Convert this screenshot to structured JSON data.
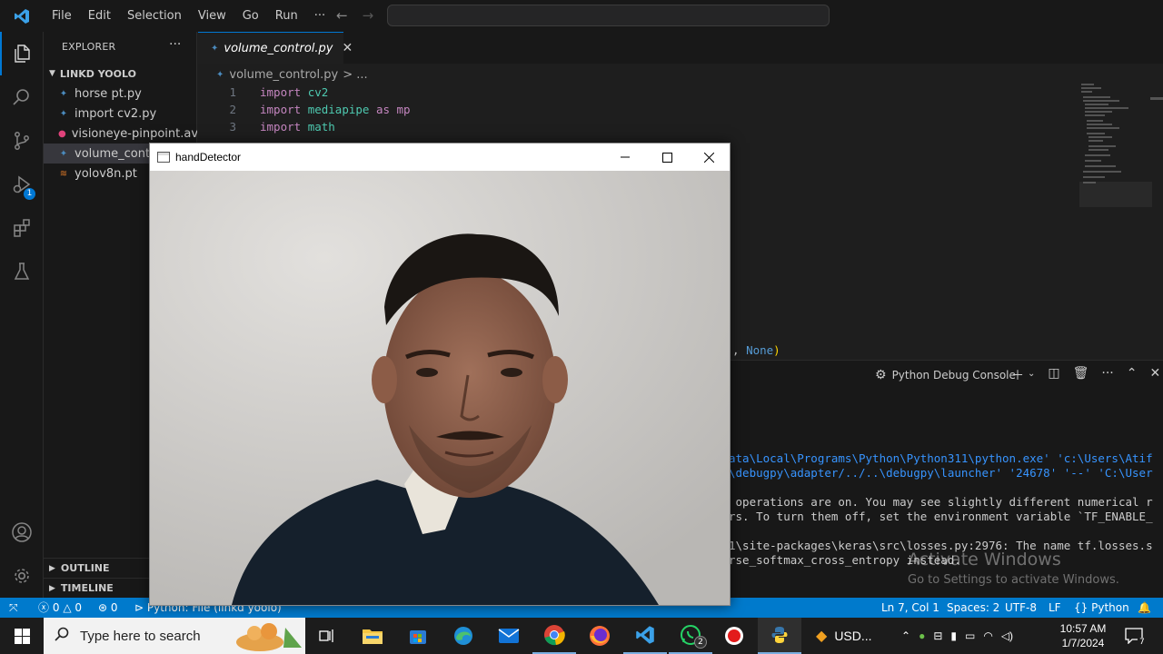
{
  "titlebar": {
    "menu": [
      "File",
      "Edit",
      "Selection",
      "View",
      "Go",
      "Run",
      "···"
    ]
  },
  "activity_bar": {
    "debug_badge": "1"
  },
  "sidebar": {
    "title": "EXPLORER",
    "more": "···",
    "folder": "LINKD YOOLO",
    "files": [
      {
        "name": "horse pt.py",
        "icon": "python-file-icon"
      },
      {
        "name": "import cv2.py",
        "icon": "python-file-icon"
      },
      {
        "name": "visioneye-pinpoint.avi",
        "icon": "video-file-icon"
      },
      {
        "name": "volume_control.py",
        "icon": "python-file-icon"
      },
      {
        "name": "yolov8n.pt",
        "icon": "rss-file-icon"
      }
    ],
    "outline": "OUTLINE",
    "timeline": "TIMELINE"
  },
  "editor": {
    "tab": "volume_control.py",
    "breadcrumb_file": "volume_control.py",
    "breadcrumb_rest": "> ...",
    "lines": [
      {
        "n": "1",
        "kw": "import",
        "mod": "cv2",
        "rest": ""
      },
      {
        "n": "2",
        "kw": "import",
        "mod": "mediapipe",
        "rest": " as mp"
      },
      {
        "n": "3",
        "kw": "import",
        "mod": "math",
        "rest": ""
      }
    ],
    "partial_code_comma": ", ",
    "partial_code_none": "None",
    "partial_code_paren": ")"
  },
  "panel": {
    "title": "Python Debug Console",
    "terminal": [
      {
        "text": "ata\\Local\\Programs\\Python\\Python311\\python.exe' 'c:\\Users\\Atif"
      },
      {
        "text": "\\debugpy\\adapter/../..\\debugpy\\launcher' '24678' '--' 'C:\\User"
      },
      {
        "text": ""
      },
      {
        "text": " operations are on. You may see slightly different numerical r"
      },
      {
        "text": "rs. To turn them off, set the environment variable `TF_ENABLE_"
      },
      {
        "text": ""
      },
      {
        "text": "1\\site-packages\\keras\\src\\losses.py:2976: The name tf.losses.s"
      },
      {
        "text": "rse_softmax_cross_entropy instead."
      }
    ],
    "activate_title": "Activate Windows",
    "activate_sub": "Go to Settings to activate Windows."
  },
  "statusbar": {
    "errors": "0",
    "warnings": "0",
    "ports": "0",
    "interpreter": "Python: File (linkd yoolo)",
    "position": "Ln 7, Col 1",
    "spaces": "Spaces: 2",
    "encoding": "UTF-8",
    "eol": "LF",
    "language": "Python"
  },
  "hand_detector": {
    "title": "handDetector"
  },
  "taskbar": {
    "search_placeholder": "Type here to search",
    "whatsapp_badge": "2",
    "usd_label": "USD...",
    "time": "10:57 AM",
    "date": "1/7/2024",
    "notification_count": "7"
  },
  "colors": {
    "accent": "#007acc",
    "editor_bg": "#1e1e1e",
    "keyword": "#c586c0",
    "module": "#4ec9b0"
  }
}
